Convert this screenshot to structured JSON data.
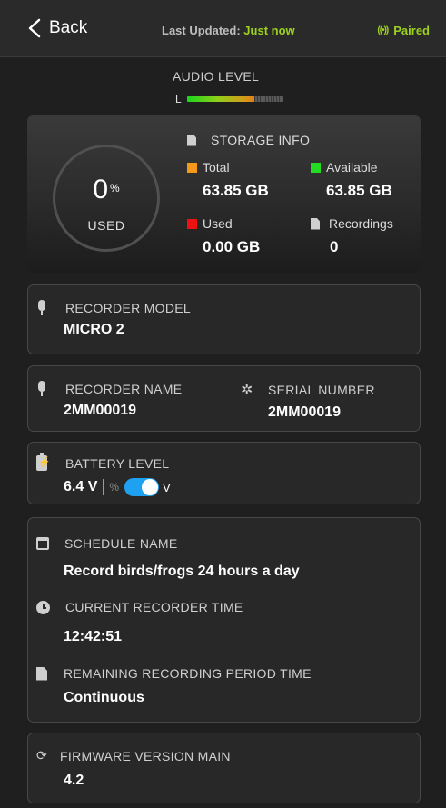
{
  "header": {
    "back_label": "Back",
    "last_updated_label": "Last Updated:",
    "last_updated_value": "Just now",
    "paired_icon": "((•))",
    "paired_label": "Paired"
  },
  "audio": {
    "title": "AUDIO LEVEL",
    "channel": "L",
    "level_fraction": 0.7
  },
  "storage": {
    "used_percent": "0",
    "percent_sign": "%",
    "used_label": "USED",
    "title": "STORAGE INFO",
    "total_label": "Total",
    "total_value": "63.85 GB",
    "available_label": "Available",
    "available_value": "63.85 GB",
    "used_item_label": "Used",
    "used_value": "0.00 GB",
    "recordings_label": "Recordings",
    "recordings_value": "0"
  },
  "colors": {
    "total": "#f39a1a",
    "available": "#22dd22",
    "used": "#ee1111",
    "accent_green": "#9bd11f",
    "toggle_blue": "#1ea1f1"
  },
  "model": {
    "label": "RECORDER MODEL",
    "value": "MICRO 2"
  },
  "name": {
    "label": "RECORDER NAME",
    "value": "2MM00019"
  },
  "serial": {
    "label": "SERIAL NUMBER",
    "value": "2MM00019"
  },
  "battery": {
    "label": "BATTERY LEVEL",
    "value": "6.4 V",
    "percent_unit": "%",
    "volt_unit": "V",
    "toggle_on": true
  },
  "schedule": {
    "label": "SCHEDULE NAME",
    "value": "Record birds/frogs 24 hours a day",
    "time_label": "CURRENT RECORDER TIME",
    "time_value": "12:42:51",
    "remaining_label": "REMAINING RECORDING PERIOD TIME",
    "remaining_value": "Continuous"
  },
  "firmware": {
    "label": "FIRMWARE VERSION MAIN",
    "value": "4.2"
  }
}
